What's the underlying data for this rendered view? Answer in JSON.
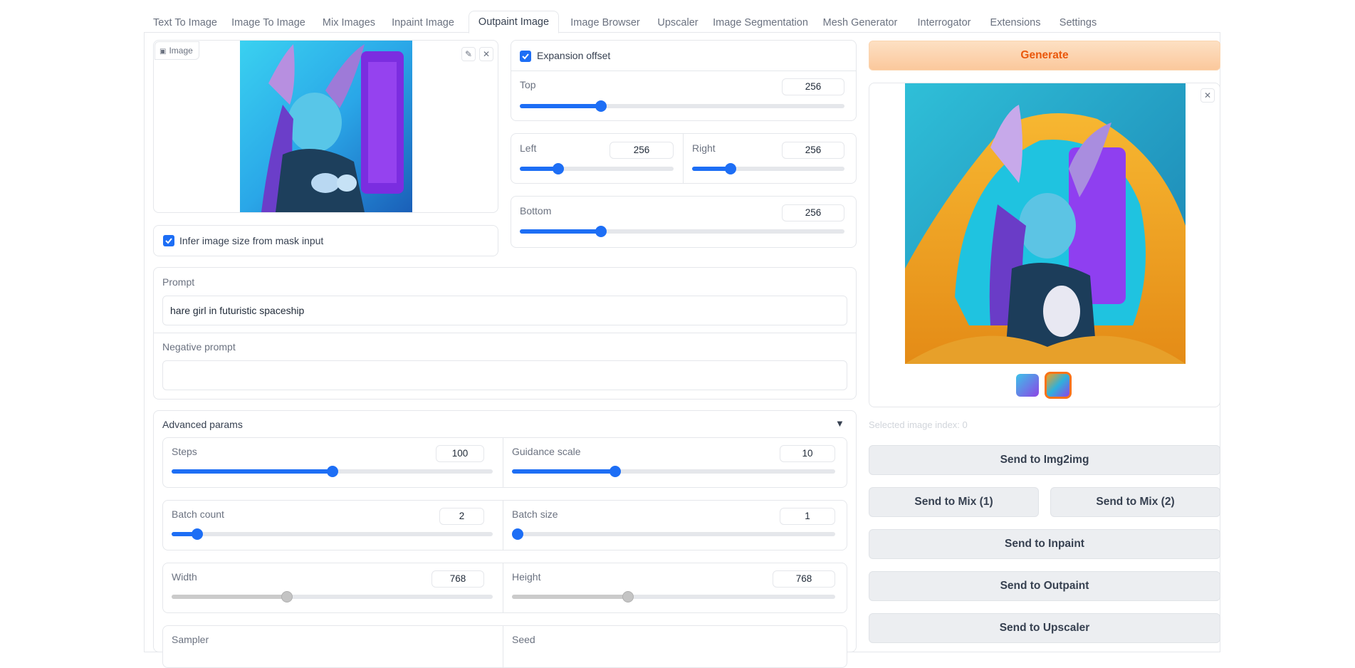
{
  "tabs": [
    {
      "label": "Text To Image",
      "active": false
    },
    {
      "label": "Image To Image",
      "active": false
    },
    {
      "label": "Mix Images",
      "active": false
    },
    {
      "label": "Inpaint Image",
      "active": false
    },
    {
      "label": "Outpaint Image",
      "active": true
    },
    {
      "label": "Image Browser",
      "active": false
    },
    {
      "label": "Upscaler",
      "active": false
    },
    {
      "label": "Image Segmentation",
      "active": false
    },
    {
      "label": "Mesh Generator",
      "active": false
    },
    {
      "label": "Interrogator",
      "active": false
    },
    {
      "label": "Extensions",
      "active": false
    },
    {
      "label": "Settings",
      "active": false
    }
  ],
  "input_image": {
    "label": "Image",
    "edit_icon": "pencil-icon",
    "clear_icon": "close-icon"
  },
  "infer_size": {
    "label": "Infer image size from mask input",
    "checked": true
  },
  "expansion": {
    "label": "Expansion offset",
    "checked": true,
    "top": {
      "label": "Top",
      "value": "256",
      "fraction": 0.25
    },
    "left": {
      "label": "Left",
      "value": "256",
      "fraction": 0.25
    },
    "right": {
      "label": "Right",
      "value": "256",
      "fraction": 0.25
    },
    "bottom": {
      "label": "Bottom",
      "value": "256",
      "fraction": 0.25
    }
  },
  "prompt": {
    "label": "Prompt",
    "value": "hare girl in futuristic spaceship"
  },
  "negative_prompt": {
    "label": "Negative prompt",
    "value": ""
  },
  "advanced": {
    "label": "Advanced params",
    "collapse_icon": "triangle-down-icon",
    "steps": {
      "label": "Steps",
      "value": "100",
      "fraction": 0.5
    },
    "guidance": {
      "label": "Guidance scale",
      "value": "10",
      "fraction": 0.32
    },
    "batch_count": {
      "label": "Batch count",
      "value": "2",
      "fraction": 0.08
    },
    "batch_size": {
      "label": "Batch size",
      "value": "1",
      "fraction": 0.0
    },
    "width": {
      "label": "Width",
      "value": "768",
      "fraction": 0.36
    },
    "height": {
      "label": "Height",
      "value": "768",
      "fraction": 0.36
    },
    "sampler": {
      "label": "Sampler"
    },
    "seed": {
      "label": "Seed"
    }
  },
  "output": {
    "generate_label": "Generate",
    "close_icon": "close-icon",
    "selected_index": "Selected image index: 0",
    "thumbnails": 2,
    "buttons": {
      "img2img": "Send to Img2img",
      "mix1": "Send to Mix (1)",
      "mix2": "Send to Mix (2)",
      "inpaint": "Send to Inpaint",
      "outpaint": "Send to Outpaint",
      "upscaler": "Send to Upscaler"
    }
  },
  "colors": {
    "accent": "#1d6ef5",
    "generate": "#ea580c"
  }
}
